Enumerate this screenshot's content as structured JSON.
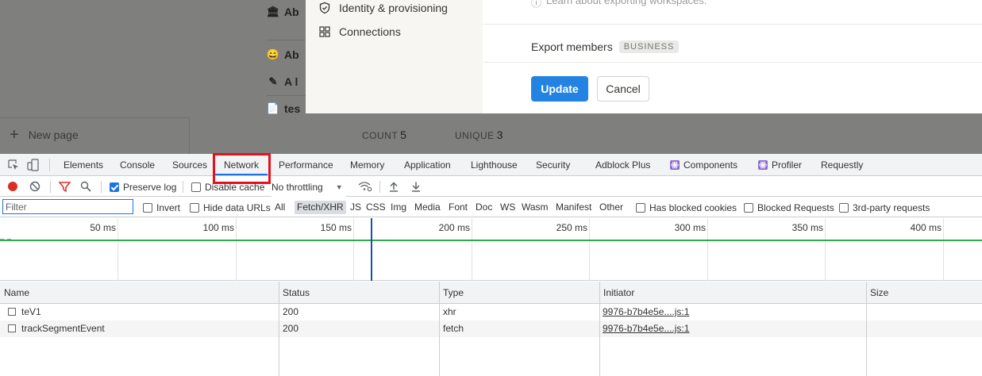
{
  "app": {
    "rows": [
      {
        "icon": "bank-icon",
        "glyph": "🏛",
        "text": "Ab"
      },
      {
        "icon": "smile-icon",
        "glyph": "😄",
        "text": "Ab"
      },
      {
        "icon": "pen-icon",
        "glyph": "✎",
        "text": "A l"
      },
      {
        "icon": "doc-icon",
        "glyph": "📄",
        "text": "tes"
      }
    ],
    "new_page": "New page",
    "count_label": "COUNT",
    "count_value": "5",
    "unique_label": "UNIQUE",
    "unique_value": "3"
  },
  "modal": {
    "sidebar": [
      {
        "label": "Identity & provisioning",
        "icon": "shield-check-icon"
      },
      {
        "label": "Connections",
        "icon": "grid-icon"
      }
    ],
    "learn_text": "Learn about exporting workspaces.",
    "export_members": "Export members",
    "badge": "BUSINESS",
    "update_label": "Update",
    "cancel_label": "Cancel",
    "accent": "#2383e2"
  },
  "devtools": {
    "tabs": [
      "Elements",
      "Console",
      "Sources",
      "Network",
      "Performance",
      "Memory",
      "Application",
      "Lighthouse",
      "Security",
      "Adblock Plus",
      "Components",
      "Profiler",
      "Requestly"
    ],
    "active_tab": "Network",
    "highlight_color": "#e8101c",
    "toolbar": {
      "preserve_log": "Preserve log",
      "preserve_log_checked": true,
      "disable_cache": "Disable cache",
      "disable_cache_checked": false,
      "throttling": "No throttling"
    },
    "filter": {
      "placeholder": "Filter",
      "invert": "Invert",
      "hide_data_urls": "Hide data URLs",
      "types": [
        "All",
        "Fetch/XHR",
        "JS",
        "CSS",
        "Img",
        "Media",
        "Font",
        "Doc",
        "WS",
        "Wasm",
        "Manifest",
        "Other"
      ],
      "selected_type": "Fetch/XHR",
      "has_blocked_cookies": "Has blocked cookies",
      "blocked_requests": "Blocked Requests",
      "third_party": "3rd-party requests"
    },
    "timeline": {
      "labels": [
        "50 ms",
        "100 ms",
        "150 ms",
        "200 ms",
        "250 ms",
        "300 ms",
        "350 ms",
        "400 ms"
      ]
    },
    "table": {
      "columns": [
        "Name",
        "Status",
        "Type",
        "Initiator",
        "Size"
      ],
      "rows": [
        {
          "name": "teV1",
          "status": "200",
          "type": "xhr",
          "initiator": "9976-b7b4e5e....js:1"
        },
        {
          "name": "trackSegmentEvent",
          "status": "200",
          "type": "fetch",
          "initiator": "9976-b7b4e5e....js:1"
        }
      ]
    }
  }
}
